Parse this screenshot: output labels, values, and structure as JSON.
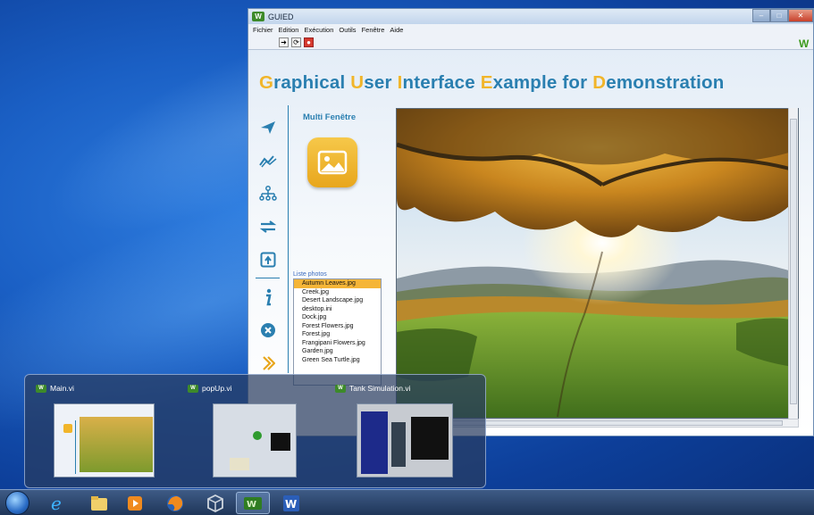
{
  "window": {
    "title": "GUIED",
    "menu": [
      "Fichier",
      "Edition",
      "Exécution",
      "Outils",
      "Fenêtre",
      "Aide"
    ],
    "toolbar_icons": [
      "run-arrow-icon",
      "run-continuous-icon",
      "stop-icon"
    ]
  },
  "header": {
    "title_parts": [
      {
        "cap": "G",
        "rest": "raphical "
      },
      {
        "cap": "U",
        "rest": "ser "
      },
      {
        "cap": "I",
        "rest": "nterface "
      },
      {
        "cap": "E",
        "rest": "xample for "
      },
      {
        "cap": "D",
        "rest": "emonstration"
      }
    ]
  },
  "panel": {
    "title": "Multi Fenêtre",
    "list_label": "Liste photos",
    "photos": [
      "Autumn Leaves.jpg",
      "Creek.jpg",
      "Desert Landscape.jpg",
      "desktop.ini",
      "Dock.jpg",
      "Forest Flowers.jpg",
      "Forest.jpg",
      "Frangipani Flowers.jpg",
      "Garden.jpg",
      "Green Sea Turtle.jpg"
    ],
    "selected_photo": "Autumn Leaves.jpg"
  },
  "sidebar": {
    "icons": [
      "send-icon",
      "chart-icon",
      "hierarchy-icon",
      "transfer-icon",
      "multi-window-icon",
      "info-icon",
      "close-circle-icon",
      "next-icon"
    ]
  },
  "thumbnails": [
    {
      "title": "Main.vi"
    },
    {
      "title": "popUp.vi"
    },
    {
      "title": "Tank Simulation.vi"
    }
  ],
  "taskbar": {
    "apps": [
      "internet-explorer-icon",
      "file-explorer-icon",
      "media-player-icon",
      "firefox-icon",
      "virtualbox-icon",
      "labview-icon",
      "word-icon"
    ],
    "active_app": "labview-icon"
  },
  "colors": {
    "title_blue": "#2a7fb0",
    "title_capitals": "#f1b52a",
    "selection": "#f5b537"
  }
}
